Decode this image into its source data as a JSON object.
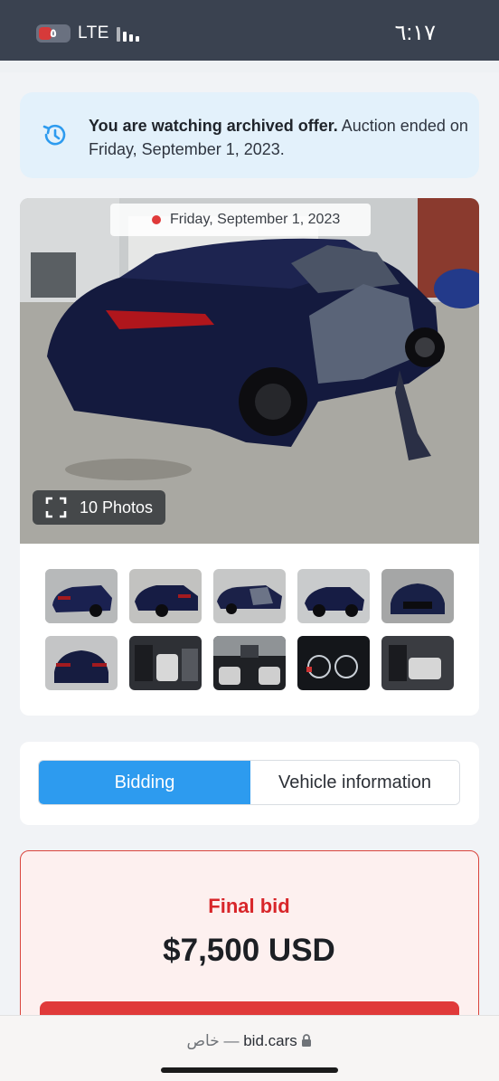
{
  "status_bar": {
    "battery_level": "٥",
    "network": "LTE",
    "time": "٦:١٧"
  },
  "notice": {
    "bold_text": "You are watching archived offer.",
    "text": " Auction ended on Friday, September 1, 2023.",
    "icon": "history-icon"
  },
  "gallery": {
    "date": "Friday, September 1, 2023",
    "photos_button": "10 Photos",
    "thumbnails": [
      {
        "name": "thumb-rear-left",
        "bg": "#5a6578"
      },
      {
        "name": "thumb-rear-right",
        "bg": "#6f7073"
      },
      {
        "name": "thumb-side-damage",
        "bg": "#8a8d90"
      },
      {
        "name": "thumb-front-left",
        "bg": "#b9bcbf"
      },
      {
        "name": "thumb-front",
        "bg": "#7c7f85"
      },
      {
        "name": "thumb-rear",
        "bg": "#9ea1a4"
      },
      {
        "name": "thumb-front-seats",
        "bg": "#3f4146"
      },
      {
        "name": "thumb-dashboard",
        "bg": "#2a2c30"
      },
      {
        "name": "thumb-instrument-cluster",
        "bg": "#1d1f22"
      },
      {
        "name": "thumb-rear-seats",
        "bg": "#474a50"
      }
    ]
  },
  "tabs": [
    {
      "label": "Bidding",
      "active": true
    },
    {
      "label": "Vehicle information",
      "active": false
    }
  ],
  "bid": {
    "label": "Final bid",
    "amount": "$7,500 USD"
  },
  "url_bar": {
    "private_label": "خاص —",
    "domain": "bid.cars"
  },
  "colors": {
    "accent": "#2d9bef",
    "alert_red": "#d8262a",
    "notice_bg": "#e3f1fb",
    "status_bar": "#3a4250"
  }
}
